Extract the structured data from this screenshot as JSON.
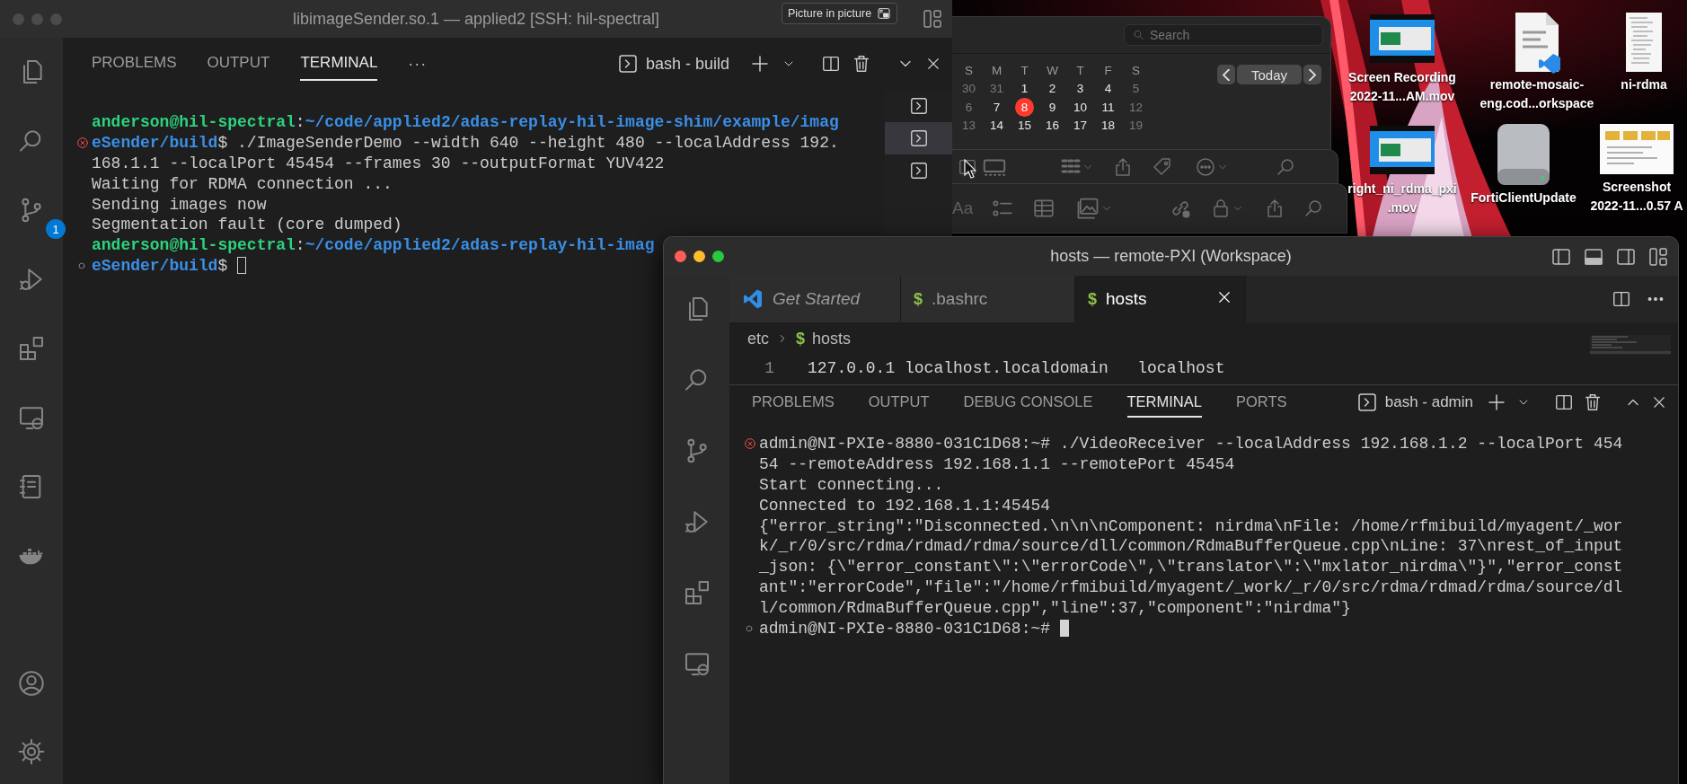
{
  "back_window": {
    "focused": false,
    "title": "libimageSender.so.1 — applied2 [SSH: hil-spectral]",
    "tooltip": "Picture in picture",
    "source_control_badge": "1",
    "panel_tabs": [
      {
        "label": "PROBLEMS",
        "selected": false
      },
      {
        "label": "OUTPUT",
        "selected": false
      },
      {
        "label": "TERMINAL",
        "selected": true
      }
    ],
    "more_glyph": "···",
    "terminal_name": "bash - build",
    "terminal_tabs": [
      {
        "selected": false
      },
      {
        "selected": true
      },
      {
        "selected": false
      }
    ],
    "terminal_lines": [
      {
        "error": false,
        "idle": false,
        "cursor": false,
        "parts": [
          {
            "kind": "user",
            "text": "anderson@hil-spectral"
          },
          {
            "kind": "plain",
            "text": ":"
          },
          {
            "kind": "path",
            "text": "~/code/applied2/adas-replay-hil-image-shim/example/imag"
          }
        ]
      },
      {
        "error": true,
        "idle": false,
        "cursor": false,
        "parts": [
          {
            "kind": "path",
            "text": "eSender/build"
          },
          {
            "kind": "plain",
            "text": "$ ./ImageSenderDemo --width 640 --height 480 --localAddress 192."
          }
        ]
      },
      {
        "error": false,
        "idle": false,
        "cursor": false,
        "parts": [
          {
            "kind": "plain",
            "text": "168.1.1 --localPort 45454 --frames 30 --outputFormat YUV422"
          }
        ]
      },
      {
        "error": false,
        "idle": false,
        "cursor": false,
        "parts": [
          {
            "kind": "plain",
            "text": "Waiting for RDMA connection ..."
          }
        ]
      },
      {
        "error": false,
        "idle": false,
        "cursor": false,
        "parts": [
          {
            "kind": "plain",
            "text": "Sending images now"
          }
        ]
      },
      {
        "error": false,
        "idle": false,
        "cursor": false,
        "parts": [
          {
            "kind": "plain",
            "text": "Segmentation fault (core dumped)"
          }
        ]
      },
      {
        "error": false,
        "idle": false,
        "cursor": false,
        "parts": [
          {
            "kind": "user",
            "text": "anderson@hil-spectral"
          },
          {
            "kind": "plain",
            "text": ":"
          },
          {
            "kind": "path",
            "text": "~/code/applied2/adas-replay-hil-imag"
          }
        ]
      },
      {
        "error": false,
        "idle": true,
        "cursor": true,
        "parts": [
          {
            "kind": "path",
            "text": "eSender/build"
          },
          {
            "kind": "plain",
            "text": "$"
          }
        ]
      }
    ]
  },
  "calendar": {
    "search_placeholder": "Search",
    "today_button": "Today",
    "weekdays": [
      "S",
      "M",
      "T",
      "W",
      "T",
      "F",
      "S"
    ],
    "weeks": [
      [
        {
          "day": "30",
          "dim": true
        },
        {
          "day": "31",
          "dim": true
        },
        {
          "day": "1",
          "dim": false
        },
        {
          "day": "2",
          "dim": false
        },
        {
          "day": "3",
          "dim": false
        },
        {
          "day": "4",
          "dim": false
        },
        {
          "day": "5",
          "dim": true
        }
      ],
      [
        {
          "day": "6",
          "dim": true
        },
        {
          "day": "7",
          "dim": false
        },
        {
          "day": "8",
          "dim": false,
          "today": true
        },
        {
          "day": "9",
          "dim": false
        },
        {
          "day": "10",
          "dim": false
        },
        {
          "day": "11",
          "dim": false
        },
        {
          "day": "12",
          "dim": true
        }
      ],
      [
        {
          "day": "13",
          "dim": true
        },
        {
          "day": "14",
          "dim": false
        },
        {
          "day": "15",
          "dim": false
        },
        {
          "day": "16",
          "dim": false
        },
        {
          "day": "17",
          "dim": false
        },
        {
          "day": "18",
          "dim": false
        },
        {
          "day": "19",
          "dim": true
        }
      ]
    ]
  },
  "notes_toolbar": {
    "format_glyph": "Aa"
  },
  "desktop_icons": [
    {
      "kind": "video",
      "label": [
        "Screen Recording",
        "2022-11...AM.mov"
      ]
    },
    {
      "kind": "code_document",
      "label": [
        "remote-mosaic-",
        "eng.cod...orkspace"
      ]
    },
    {
      "kind": "text_file",
      "label": [
        "ni-rdma"
      ]
    },
    {
      "kind": "video",
      "label": [
        "right_ni_rdma_pxi",
        ".mov"
      ]
    },
    {
      "kind": "drive",
      "label": [
        "FortiClientUpdate"
      ]
    },
    {
      "kind": "screenshot",
      "label": [
        "Screenshot",
        "2022-11...0.57 A"
      ]
    }
  ],
  "front_window": {
    "focused": true,
    "title": "hosts — remote-PXI (Workspace)",
    "editor_tabs": [
      {
        "kind": "welcome",
        "label": "Get Started",
        "selected": false
      },
      {
        "kind": "shell",
        "glyph": "$",
        "label": ".bashrc",
        "selected": false
      },
      {
        "kind": "shell",
        "glyph": "$",
        "label": "hosts",
        "selected": true
      }
    ],
    "breadcrumb": {
      "folder": "etc",
      "glyph": "$",
      "file": "hosts"
    },
    "code_lines": [
      {
        "number": "1",
        "text": "127.0.0.1 localhost.localdomain   localhost"
      }
    ],
    "panel_tabs": [
      {
        "label": "PROBLEMS",
        "selected": false
      },
      {
        "label": "OUTPUT",
        "selected": false
      },
      {
        "label": "DEBUG CONSOLE",
        "selected": false
      },
      {
        "label": "TERMINAL",
        "selected": true
      },
      {
        "label": "PORTS",
        "selected": false
      }
    ],
    "terminal_name": "bash - admin",
    "terminal_lines": [
      {
        "error": true,
        "idle": false,
        "cursor": false,
        "parts": [
          {
            "kind": "plain",
            "text": "admin@NI-PXIe-8880-031C1D68:~# ./VideoReceiver --localAddress 192.168.1.2 --localPort 454"
          }
        ]
      },
      {
        "error": false,
        "idle": false,
        "cursor": false,
        "parts": [
          {
            "kind": "plain",
            "text": "54 --remoteAddress 192.168.1.1 --remotePort 45454"
          }
        ]
      },
      {
        "error": false,
        "idle": false,
        "cursor": false,
        "parts": [
          {
            "kind": "plain",
            "text": "Start connecting..."
          }
        ]
      },
      {
        "error": false,
        "idle": false,
        "cursor": false,
        "parts": [
          {
            "kind": "plain",
            "text": "Connected to 192.168.1.1:45454"
          }
        ]
      },
      {
        "error": false,
        "idle": false,
        "cursor": false,
        "parts": [
          {
            "kind": "plain",
            "text": "{\"error_string\":\"Disconnected.\\n\\n\\nComponent: nirdma\\nFile: /home/rfmibuild/myagent/_wor"
          }
        ]
      },
      {
        "error": false,
        "idle": false,
        "cursor": false,
        "parts": [
          {
            "kind": "plain",
            "text": "k/_r/0/src/rdma/rdmad/rdma/source/dll/common/RdmaBufferQueue.cpp\\nLine: 37\\nrest_of_input"
          }
        ]
      },
      {
        "error": false,
        "idle": false,
        "cursor": false,
        "parts": [
          {
            "kind": "plain",
            "text": "_json: {\\\"error_constant\\\":\\\"errorCode\\\",\\\"translator\\\":\\\"mxlator_nirdma\\\"}\",\"error_const"
          }
        ]
      },
      {
        "error": false,
        "idle": false,
        "cursor": false,
        "parts": [
          {
            "kind": "plain",
            "text": "ant\":\"errorCode\",\"file\":\"/home/rfmibuild/myagent/_work/_r/0/src/rdma/rdmad/rdma/source/dl"
          }
        ]
      },
      {
        "error": false,
        "idle": false,
        "cursor": false,
        "parts": [
          {
            "kind": "plain",
            "text": "l/common/RdmaBufferQueue.cpp\",\"line\":37,\"component\":\"nirdma\"}"
          }
        ]
      },
      {
        "error": false,
        "idle": true,
        "cursor": true,
        "parts": [
          {
            "kind": "plain",
            "text": "admin@NI-PXIe-8880-031C1D68:~#"
          }
        ]
      }
    ]
  }
}
